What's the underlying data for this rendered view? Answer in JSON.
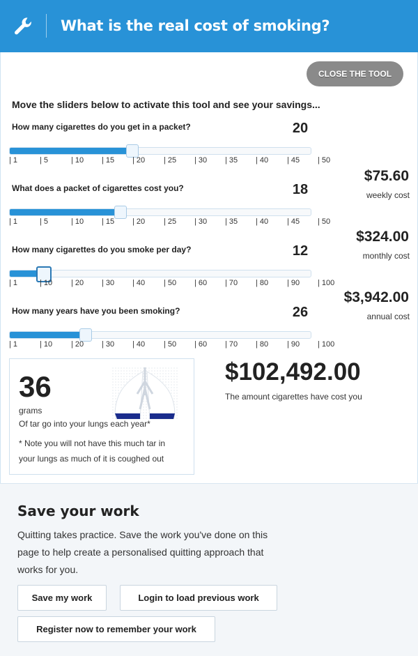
{
  "header": {
    "title": "What is the real cost of smoking?",
    "icon": "wrench-icon",
    "background": "#2892d7"
  },
  "close_button": "CLOSE THE TOOL",
  "intro": "Move the sliders below to activate this tool and see your savings...",
  "sliders": [
    {
      "question": "How many cigarettes do you get in a packet?",
      "value": "20",
      "level": 0.408,
      "ticks": [
        "| 1",
        "| 5",
        "| 10",
        "| 15",
        "| 20",
        "| 25",
        "| 30",
        "| 35",
        "| 40",
        "| 45",
        "| 50"
      ]
    },
    {
      "question": "What does a packet of cigarettes cost you?",
      "value": "18",
      "level": 0.367,
      "ticks": [
        "| 1",
        "| 5",
        "| 10",
        "| 15",
        "| 20",
        "| 25",
        "| 30",
        "| 35",
        "| 40",
        "| 45",
        "| 50"
      ]
    },
    {
      "question": "How many cigarettes do you smoke per day?",
      "value": "12",
      "level": 0.111,
      "ticks": [
        "| 1",
        "| 10",
        "| 20",
        "| 30",
        "| 40",
        "| 50",
        "| 60",
        "| 70",
        "| 80",
        "| 90",
        "| 100"
      ]
    },
    {
      "question": "How many years have you been smoking?",
      "value": "26",
      "level": 0.253,
      "ticks": [
        "| 1",
        "| 10",
        "| 20",
        "| 30",
        "| 40",
        "| 50",
        "| 60",
        "| 70",
        "| 80",
        "| 90",
        "| 100"
      ]
    }
  ],
  "costs": [
    {
      "amount": "$75.60",
      "label": "weekly cost"
    },
    {
      "amount": "$324.00",
      "label": "monthly cost"
    },
    {
      "amount": "$3,942.00",
      "label": "annual cost"
    }
  ],
  "tar": {
    "amount": "36",
    "unit": "grams",
    "description": "Of tar go into your lungs each year*",
    "note": "* Note you will not have this much tar in your lungs as much of it is coughed out"
  },
  "total": {
    "amount": "$102,492.00",
    "label": "The amount cigarettes have cost you"
  },
  "save": {
    "title": "Save your work",
    "text": "Quitting takes practice. Save the work you've done on this page to help create a personalised quitting approach that works for you.",
    "buttons": [
      "Save my work",
      "Login to load previous work",
      "Register now to remember your work"
    ]
  },
  "colors": {
    "accent": "#2892d7",
    "close_button": "#8a8a8a",
    "active_handle_border": "#2b79b5",
    "lung_tar": "#1a2c8c"
  }
}
